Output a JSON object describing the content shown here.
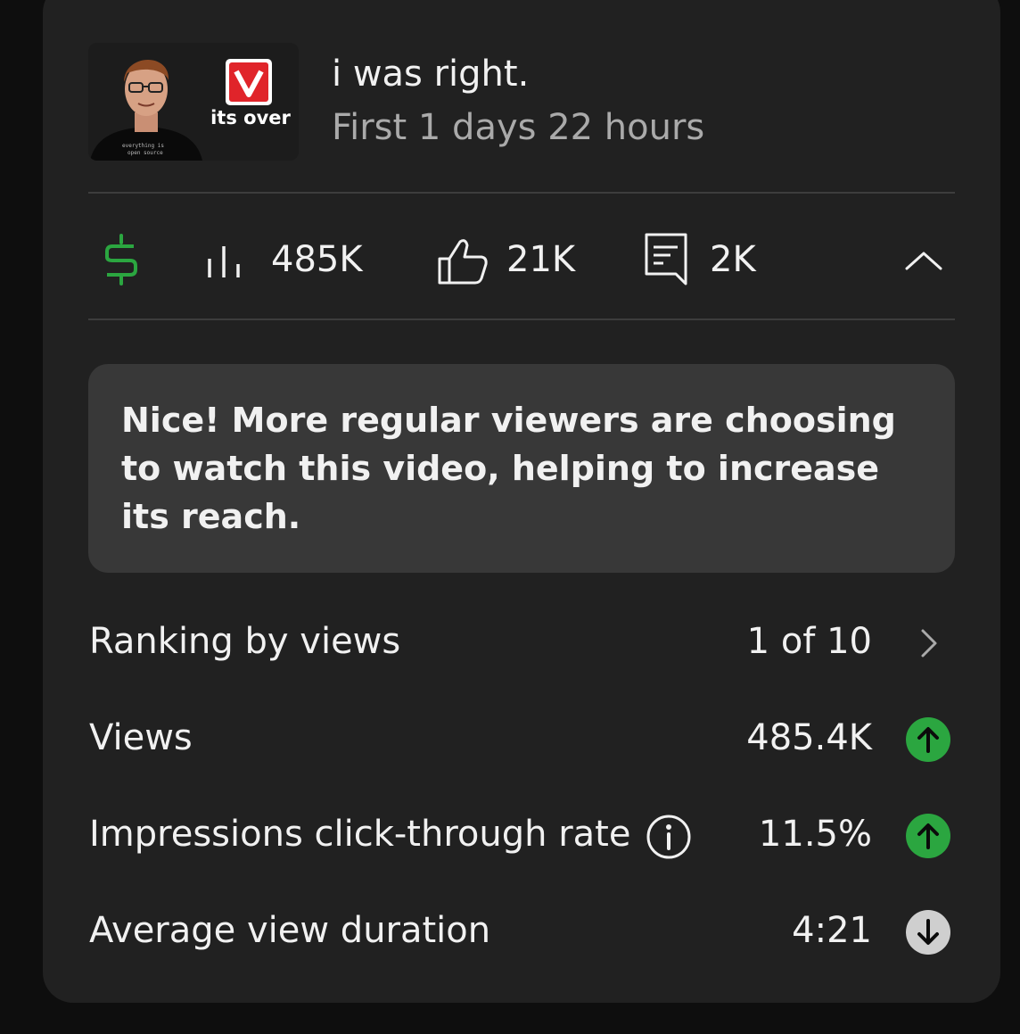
{
  "video": {
    "thumbnail_text": "its over",
    "title": "i was right.",
    "age": "First 1 days 22 hours"
  },
  "stats": {
    "revenue_icon": "dollar-icon",
    "views": "485K",
    "likes": "21K",
    "comments": "2K"
  },
  "banner": {
    "text": "Nice! More regular viewers are choosing to watch this video, helping to increase its reach."
  },
  "metrics": [
    {
      "label": "Ranking by views",
      "value": "1 of 10",
      "indicator": "chevron-right"
    },
    {
      "label": "Views",
      "value": "485.4K",
      "indicator": "up"
    },
    {
      "label": "Impressions click-through rate",
      "value": "11.5%",
      "indicator": "up"
    },
    {
      "label": "Average view duration",
      "value": "4:21",
      "indicator": "down"
    }
  ],
  "colors": {
    "card": "#212121",
    "banner": "#383838",
    "trend_up": "#2ba640",
    "trend_down": "#cfcfcf",
    "revenue": "#2ba640"
  }
}
